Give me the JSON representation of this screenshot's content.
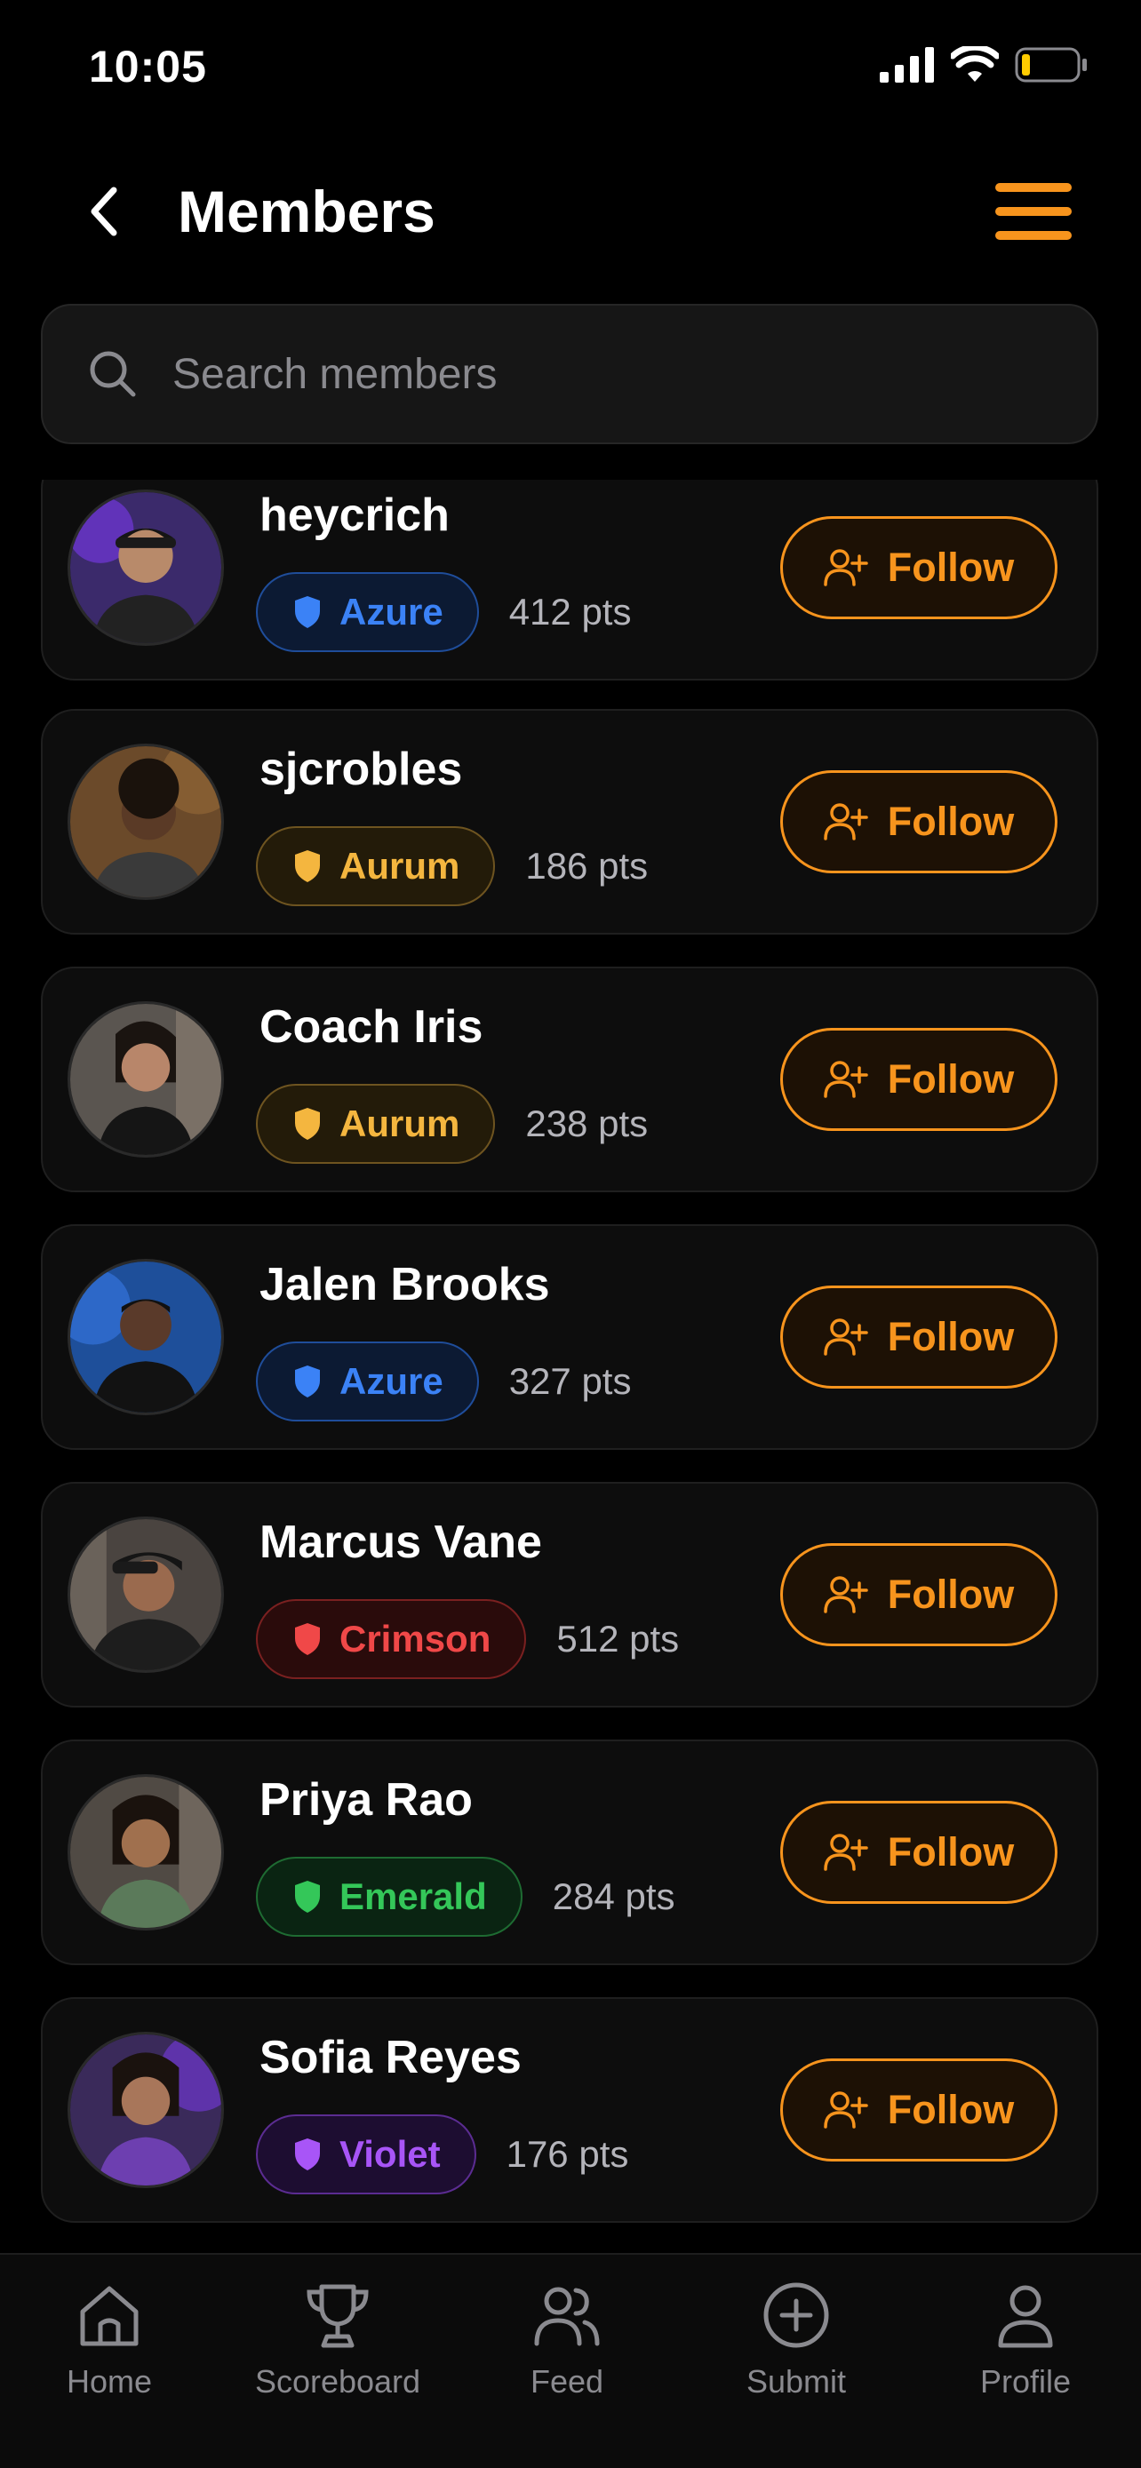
{
  "status": {
    "time": "10:05"
  },
  "header": {
    "title": "Members"
  },
  "search": {
    "placeholder": "Search members"
  },
  "members": [
    {
      "name": "heycrich",
      "tier": "Azure",
      "points": "412 pts",
      "follow_label": "Follow",
      "tier_color": "#3b82f6"
    },
    {
      "name": "sjcrobles",
      "tier": "Aurum",
      "points": "186 pts",
      "follow_label": "Follow",
      "tier_color": "#f4b63f"
    },
    {
      "name": "Coach Iris",
      "tier": "Aurum",
      "points": "238 pts",
      "follow_label": "Follow",
      "tier_color": "#f4b63f"
    },
    {
      "name": "Jalen Brooks",
      "tier": "Azure",
      "points": "327 pts",
      "follow_label": "Follow",
      "tier_color": "#3b82f6"
    },
    {
      "name": "Marcus Vane",
      "tier": "Crimson",
      "points": "512 pts",
      "follow_label": "Follow",
      "tier_color": "#f04848"
    },
    {
      "name": "Priya Rao",
      "tier": "Emerald",
      "points": "284 pts",
      "follow_label": "Follow",
      "tier_color": "#34c759"
    },
    {
      "name": "Sofia Reyes",
      "tier": "Violet",
      "points": "176 pts",
      "follow_label": "Follow",
      "tier_color": "#a855f7"
    }
  ],
  "tabs": [
    {
      "label": "Home",
      "icon": "home-icon"
    },
    {
      "label": "Scoreboard",
      "icon": "trophy-icon"
    },
    {
      "label": "Feed",
      "icon": "users-icon"
    },
    {
      "label": "Submit",
      "icon": "plus-circle-icon"
    },
    {
      "label": "Profile",
      "icon": "user-icon"
    }
  ],
  "colors": {
    "accent": "#f7941d",
    "background": "#000000",
    "card": "#0d0d0d"
  }
}
